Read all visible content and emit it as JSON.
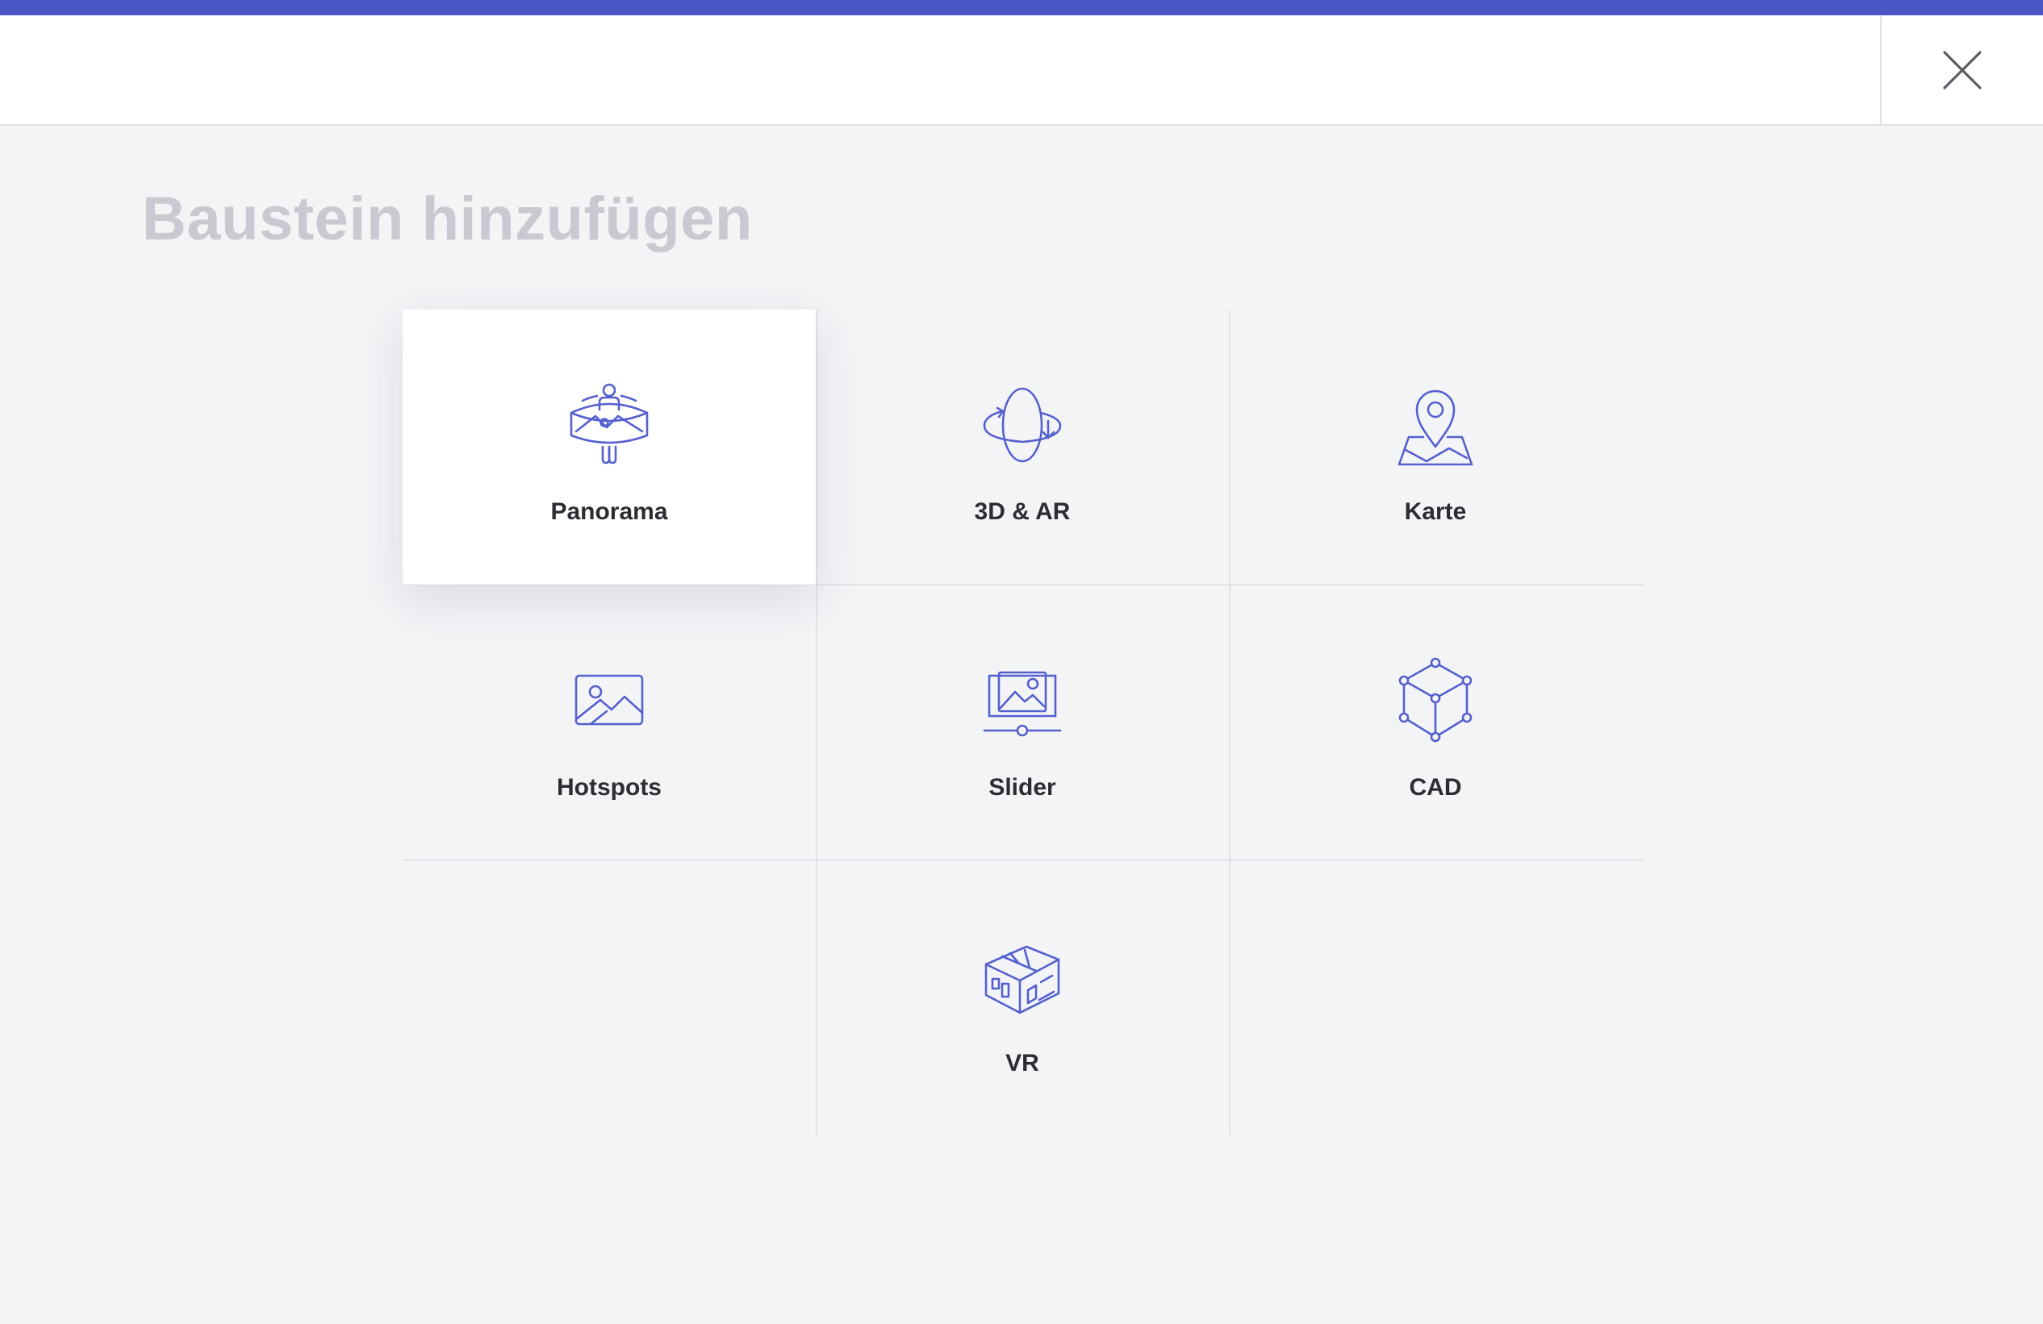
{
  "modal": {
    "title": "Baustein hinzufügen",
    "close_icon": "close-icon"
  },
  "colors": {
    "accent": "#4b57c7",
    "icon": "#5560cf",
    "background": "#f3f4f6",
    "title": "#c9cad1"
  },
  "tiles": [
    {
      "label": "Panorama",
      "icon": "panorama-icon",
      "selected": true
    },
    {
      "label": "3D & AR",
      "icon": "rotate-3d-icon",
      "selected": false
    },
    {
      "label": "Karte",
      "icon": "map-pin-icon",
      "selected": false
    },
    {
      "label": "Hotspots",
      "icon": "image-icon",
      "selected": false
    },
    {
      "label": "Slider",
      "icon": "image-slider-icon",
      "selected": false
    },
    {
      "label": "CAD",
      "icon": "cube-icon",
      "selected": false
    },
    {
      "label": "VR",
      "icon": "vr-house-icon",
      "selected": false
    }
  ]
}
